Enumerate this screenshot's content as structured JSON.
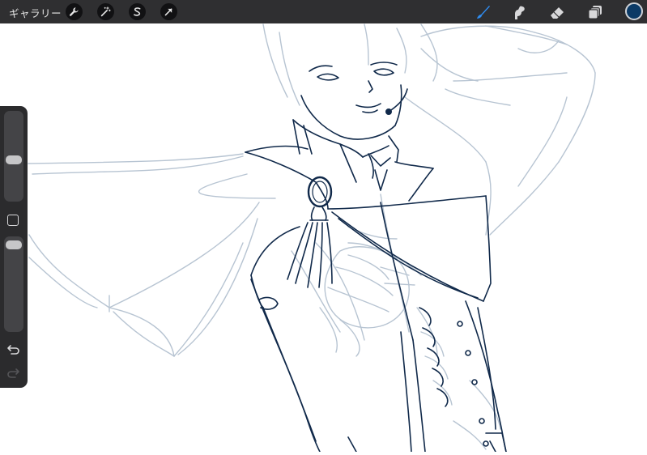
{
  "app": {
    "gallery_label": "ギャラリー"
  },
  "toolbar": {
    "left_buttons": [
      {
        "icon": "wrench-icon",
        "label": "actions"
      },
      {
        "icon": "magic-wand-icon",
        "label": "adjustments"
      },
      {
        "icon": "selection-s-icon",
        "label": "selection"
      },
      {
        "icon": "transform-arrow-icon",
        "label": "transform"
      }
    ],
    "right_tools": [
      {
        "icon": "brush-icon",
        "active": true
      },
      {
        "icon": "smudge-icon",
        "active": false
      },
      {
        "icon": "eraser-icon",
        "active": false
      },
      {
        "icon": "layers-icon",
        "active": false
      }
    ],
    "current_color": "#0b3a66"
  },
  "sidebar": {
    "brush_size_level": 0.45,
    "opacity_level": 0.97,
    "modify_button": "square-icon",
    "undo": "undo-icon",
    "redo": "redo-icon"
  },
  "colors": {
    "toolbar_bg": "#2f2f31",
    "active_tool": "#2f8cf0",
    "ink": "#0e2a4a",
    "sketch": "#b9c6d3"
  }
}
